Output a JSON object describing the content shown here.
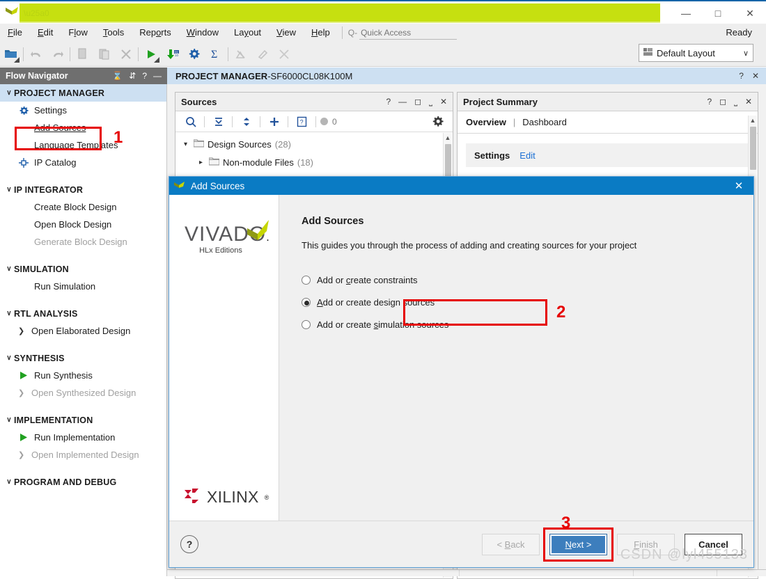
{
  "window": {
    "app_icon": "vivado-logo-icon",
    "title_redacted": true,
    "minimize": "—",
    "maximize": "□",
    "close": "✕"
  },
  "menubar": {
    "items": [
      {
        "label": "File",
        "accel": "F"
      },
      {
        "label": "Edit",
        "accel": "E"
      },
      {
        "label": "Flow",
        "accel": "l"
      },
      {
        "label": "Tools",
        "accel": "T"
      },
      {
        "label": "Reports",
        "accel": "o"
      },
      {
        "label": "Window",
        "accel": "W"
      },
      {
        "label": "Layout",
        "accel": "y"
      },
      {
        "label": "View",
        "accel": "V"
      },
      {
        "label": "Help",
        "accel": "H"
      }
    ],
    "quick_access_placeholder": "Quick Access",
    "quick_access_value": "",
    "status": "Ready"
  },
  "toolbar": {
    "buttons": [
      {
        "name": "open-project-icon",
        "enabled": true
      },
      {
        "name": "undo-icon",
        "enabled": false
      },
      {
        "name": "redo-icon",
        "enabled": false
      },
      {
        "name": "copy-icon",
        "enabled": false
      },
      {
        "name": "paste-icon",
        "enabled": false
      },
      {
        "name": "delete-icon",
        "enabled": false
      },
      {
        "name": "run-icon",
        "enabled": true
      },
      {
        "name": "download-bitstream-icon",
        "enabled": true
      },
      {
        "name": "settings-gear-icon",
        "enabled": true
      },
      {
        "name": "sigma-report-icon",
        "enabled": true
      },
      {
        "name": "timing-report-icon",
        "enabled": false
      },
      {
        "name": "marker-icon",
        "enabled": false
      },
      {
        "name": "clear-marks-icon",
        "enabled": false
      }
    ],
    "layout_select": {
      "label": "Default Layout",
      "icon": "layout-icon",
      "chevron": "∨"
    }
  },
  "flow_navigator": {
    "title": "Flow Navigator",
    "header_icons": [
      "collapse-all-icon",
      "expand-collapse-icon",
      "help-icon",
      "minimize-icon"
    ],
    "sections": [
      {
        "label": "PROJECT MANAGER",
        "active": true,
        "chevron": "∨",
        "items": [
          {
            "label": "Settings",
            "icon": "gear-icon",
            "style": "plain",
            "disabled": false
          },
          {
            "label": "Add Sources",
            "icon": "",
            "style": "link",
            "disabled": false,
            "highlighted": true
          },
          {
            "label": "Language Templates",
            "icon": "",
            "style": "plain",
            "disabled": false
          },
          {
            "label": "IP Catalog",
            "icon": "ip-catalog-icon",
            "style": "plain",
            "disabled": false
          }
        ]
      },
      {
        "label": "IP INTEGRATOR",
        "active": false,
        "chevron": "∨",
        "items": [
          {
            "label": "Create Block Design",
            "icon": "",
            "style": "plain",
            "disabled": false
          },
          {
            "label": "Open Block Design",
            "icon": "",
            "style": "plain",
            "disabled": false
          },
          {
            "label": "Generate Block Design",
            "icon": "",
            "style": "plain",
            "disabled": true
          }
        ]
      },
      {
        "label": "SIMULATION",
        "active": false,
        "chevron": "∨",
        "items": [
          {
            "label": "Run Simulation",
            "icon": "",
            "style": "plain",
            "disabled": false
          }
        ]
      },
      {
        "label": "RTL ANALYSIS",
        "active": false,
        "chevron": "∨",
        "items": [
          {
            "label": "Open Elaborated Design",
            "icon": "arrow",
            "style": "plain",
            "disabled": false
          }
        ]
      },
      {
        "label": "SYNTHESIS",
        "active": false,
        "chevron": "∨",
        "items": [
          {
            "label": "Run Synthesis",
            "icon": "play-icon",
            "style": "plain",
            "disabled": false
          },
          {
            "label": "Open Synthesized Design",
            "icon": "arrow",
            "style": "plain",
            "disabled": true
          }
        ]
      },
      {
        "label": "IMPLEMENTATION",
        "active": false,
        "chevron": "∨",
        "items": [
          {
            "label": "Run Implementation",
            "icon": "play-icon",
            "style": "plain",
            "disabled": false
          },
          {
            "label": "Open Implemented Design",
            "icon": "arrow",
            "style": "plain",
            "disabled": true
          }
        ]
      },
      {
        "label": "PROGRAM AND DEBUG",
        "active": false,
        "chevron": "∨",
        "items": []
      }
    ]
  },
  "project_manager": {
    "title_prefix": "PROJECT MANAGER",
    "title_sep": " - ",
    "project_name": "SF6000CL08K100M",
    "icons": [
      "help-icon",
      "close-icon"
    ]
  },
  "sources_panel": {
    "title": "Sources",
    "header_icons": [
      "help-icon",
      "minimize-icon",
      "maximize-icon",
      "float-icon",
      "close-icon"
    ],
    "toolbar": {
      "search_icon": "search-icon",
      "collapse_icon": "collapse-all-icon",
      "expand_icon": "expand-all-icon",
      "add_icon": "add-sources-plus-icon",
      "report_icon": "report-icon",
      "status_dot_label": "0",
      "gear_icon": "gear-icon"
    },
    "tree": [
      {
        "label": "Design Sources",
        "count": "(28)",
        "expanded": true,
        "depth": 0
      },
      {
        "label": "Non-module Files",
        "count": "(18)",
        "expanded": false,
        "depth": 1
      }
    ]
  },
  "summary_panel": {
    "title": "Project Summary",
    "header_icons": [
      "help-icon",
      "maximize-icon",
      "float-icon",
      "close-icon"
    ],
    "tabs": [
      {
        "label": "Overview",
        "active": true
      },
      {
        "label": "Dashboard",
        "active": false
      }
    ],
    "tab_divider": "|",
    "settings_label": "Settings",
    "settings_edit_link": "Edit"
  },
  "dialog": {
    "title": "Add Sources",
    "title_icon": "vivado-logo-icon",
    "close_icon": "✕",
    "brand": {
      "vivado_word": "VIVADO",
      "vivado_dot": ".",
      "vivado_sub": "HLx Editions",
      "xilinx_word": "XILINX",
      "xilinx_reg": "®"
    },
    "heading": "Add Sources",
    "description": "This guides you through the process of adding and creating sources for your project",
    "options": [
      {
        "label_pre": "Add or ",
        "accel": "c",
        "label_post": "reate constraints",
        "selected": false,
        "name": "add-or-create-constraints"
      },
      {
        "label_pre": "",
        "accel": "A",
        "label_post": "dd or create design sources",
        "selected": true,
        "name": "add-or-create-design-sources",
        "highlighted": true
      },
      {
        "label_pre": "Add or create ",
        "accel": "s",
        "label_post": "imulation sources",
        "selected": false,
        "name": "add-or-create-simulation-sources"
      }
    ],
    "help_button": "?",
    "buttons": [
      {
        "label_pre": "< ",
        "accel": "B",
        "label_post": "ack",
        "state": "disabled",
        "name": "back-button"
      },
      {
        "label_pre": "",
        "accel": "N",
        "label_post": "ext >",
        "state": "primary",
        "name": "next-button",
        "highlighted": true
      },
      {
        "label_pre": "",
        "accel": "F",
        "label_post": "inish",
        "state": "disabled",
        "name": "finish-button"
      },
      {
        "label_pre": "",
        "accel": "",
        "label_post": "Cancel",
        "state": "strong",
        "name": "cancel-button"
      }
    ]
  },
  "annotations": {
    "step1": "1",
    "step2": "2",
    "step3": "3",
    "highlight_color": "#e60000"
  },
  "watermark": "CSDN @lyl455133",
  "colors": {
    "title_accent": "#1565a8",
    "dialog_title_bg": "#0a7bc4",
    "active_section_bg": "#cde0f2",
    "flownav_header_bg": "#6f6f6f",
    "redaction": "#c6e010",
    "primary_button": "#3d7ebd",
    "link": "#1a6fd4",
    "xilinx_red": "#c8102e"
  }
}
